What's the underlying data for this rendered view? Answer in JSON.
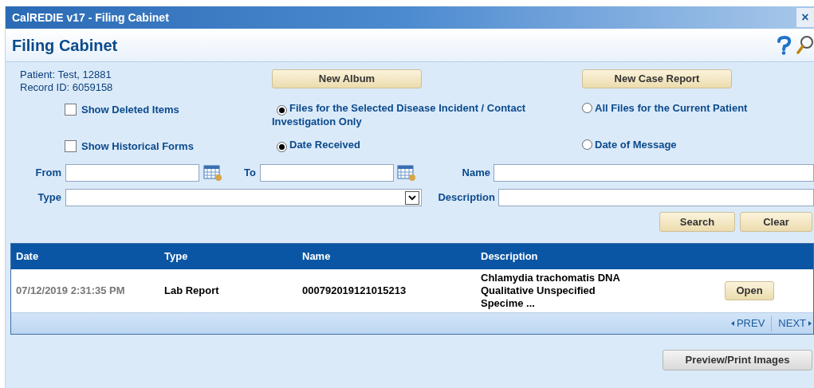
{
  "window": {
    "title": "CalREDIE v17 - Filing Cabinet",
    "close": "×"
  },
  "header": {
    "title": "Filing Cabinet"
  },
  "patient": {
    "name_line": "Patient: Test, 12881",
    "record_line": "Record ID: 6059158"
  },
  "top_buttons": [
    "New Album",
    "New Case Report"
  ],
  "option_rows": [
    {
      "checkbox": {
        "label": "Show Deleted Items",
        "checked": false
      },
      "radios": [
        {
          "label": "Files for the Selected Disease Incident / Contact Investigation Only",
          "selected": true
        },
        {
          "label": "All Files for the Current Patient",
          "selected": false
        }
      ]
    },
    {
      "checkbox": {
        "label": "Show Historical Forms",
        "checked": false
      },
      "radios": [
        {
          "label": "Date Received",
          "selected": true
        },
        {
          "label": "Date of Message",
          "selected": false
        }
      ]
    }
  ],
  "filters": {
    "from_label": "From",
    "to_label": "To",
    "name_label": "Name",
    "type_label": "Type",
    "description_label": "Description"
  },
  "action_buttons": [
    "Search",
    "Clear"
  ],
  "table": {
    "columns": [
      "Date",
      "Type",
      "Name",
      "Description"
    ],
    "rows": [
      {
        "date": "07/12/2019 2:31:35 PM",
        "type": "Lab Report",
        "name": "000792019121015213",
        "description": "Chlamydia trachomatis DNA Qualitative Unspecified Specime ...",
        "button": "Open"
      }
    ],
    "pager": {
      "prev": "PREV",
      "next": "NEXT"
    }
  },
  "bottom_button": "Preview/Print Images"
}
